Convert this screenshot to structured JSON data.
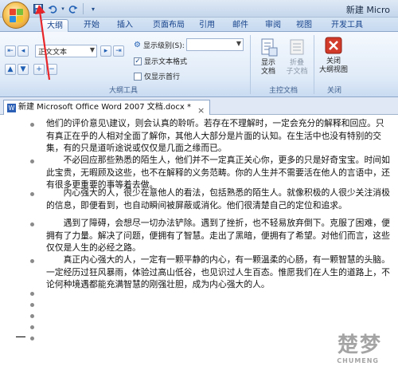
{
  "titlebar": {
    "window_title": "新建 Micro",
    "qat": [
      "save-icon",
      "undo-icon",
      "redo-icon",
      "customize-icon"
    ]
  },
  "tabs": [
    {
      "label": "大纲",
      "active": true
    },
    {
      "label": "开始"
    },
    {
      "label": "插入"
    },
    {
      "label": "页面布局"
    },
    {
      "label": "引用"
    },
    {
      "label": "邮件"
    },
    {
      "label": "审阅"
    },
    {
      "label": "视图"
    },
    {
      "label": "开发工具"
    }
  ],
  "ribbon": {
    "outline_tools": {
      "group_label": "大纲工具",
      "level_combo": "正文文本",
      "show_level_label": "显示级别(S):",
      "show_level_value": "",
      "show_text_format": "显示文本格式",
      "show_text_format_checked": true,
      "first_line_only": "仅显示首行",
      "first_line_only_checked": false
    },
    "master_document": {
      "group_label": "主控文档",
      "show_document": "显示\n文档",
      "collapse_subdocs": "折叠\n子文档"
    },
    "close": {
      "group_label": "关闭",
      "close_outline": "关闭\n大纲视图"
    }
  },
  "document": {
    "tab_label": "新建 Microsoft Office Word 2007 文档.docx *",
    "paragraphs": [
      "他们的评价意见\\建议，则会认真的聆听。若存在不理解时，一定会充分的解释和回应。只有真正在乎的人相对全面了解你，其他人大部分是片面的认知。在生活中也没有特别的交集，有的只是道听途说或仅仅是几面之缘而已。",
      "　　不必回应那些熟悉的陌生人，他们并不一定真正关心你，更多的只是好奇宝宝。时间如此宝贵，无暇顾及这些，也不在解释的义务范畴。你的人生并不需要活在他人的言语中，还有很多更重要的事等着去做。",
      "　　内心强大的人，很少在意他人的看法，包括熟悉的陌生人。就像积极的人很少关注消极的信息，即便看到，也自动瞬间被屏蔽或消化。他们很清楚自己的定位和追求。",
      "　　遇到了障碍，会想尽一切办法铲除。遇到了挫折，也不轻易放弃倒下。克服了困难，便拥有了力量。解决了问题，便拥有了智慧。走出了黑暗，便拥有了希望。对他们而言，这些仅仅是人生的必经之路。",
      "　　真正内心强大的人，一定有一颗平静的内心，有一颗温柔的心肠，有一颗智慧的头脑。一定经历过狂风暴雨，体验过高山低谷，也见识过人生百态。惟愿我们在人生的道路上，不论何种境遇都能充满智慧的刚强壮胆，成为内心强大的人。"
    ],
    "empty_bullets": 5
  },
  "watermark": {
    "brand": "楚梦",
    "sub": "CHUMENG"
  },
  "colors": {
    "accent": "#15428b",
    "arrow": "#e8262a",
    "close_red": "#d23a2a"
  }
}
